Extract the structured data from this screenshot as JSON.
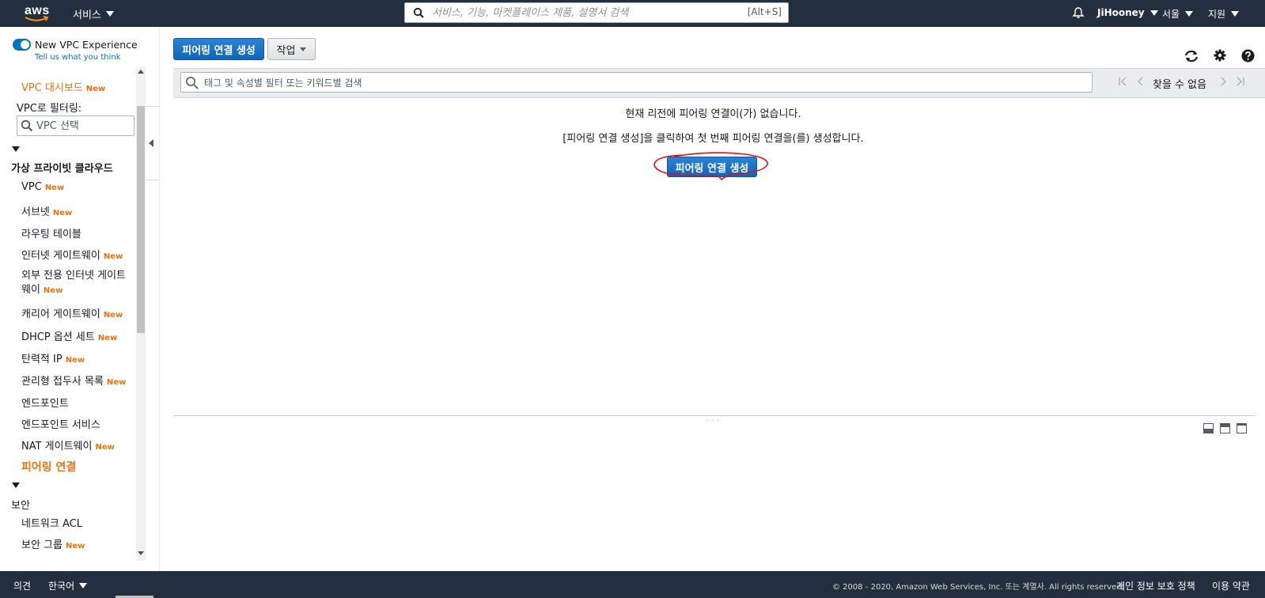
{
  "topnav": {
    "logo_text": "aws",
    "services_label": "서비스",
    "search_placeholder": "서비스, 기능, 마켓플레이스 제품, 설명서 검색",
    "search_shortcut": "[Alt+S]",
    "user_label": "JiHooney",
    "region_label": "서울",
    "support_label": "지원",
    "icons": [
      "search-icon",
      "bell-icon"
    ]
  },
  "sidebar": {
    "toggle_label": "New VPC Experience",
    "toggle_sub": "Tell us what you think",
    "toggle_on": true,
    "dashboard": "VPC 대시보드",
    "new_badge": "New",
    "filter_label": "VPC로 필터링:",
    "vpc_select_placeholder": "VPC 선택",
    "section_vpc": "가상 프라이빗 클라우드",
    "items": [
      {
        "label": "VPC",
        "new": true
      },
      {
        "label": "서브넷",
        "new": true
      },
      {
        "label": "라우팅 테이블",
        "new": false
      },
      {
        "label": "인터넷 게이트웨이",
        "new": true
      },
      {
        "label": "외부 전용 인터넷 게이트",
        "label2": "웨이",
        "new": true
      },
      {
        "label": "캐리어 게이트웨이",
        "new": true
      },
      {
        "label": "DHCP 옵션 세트",
        "new": true
      },
      {
        "label": "탄력적 IP",
        "new": true
      },
      {
        "label": "관리형 접두사 목록",
        "new": true
      },
      {
        "label": "엔드포인트",
        "new": false
      },
      {
        "label": "엔드포인트 서비스",
        "new": false
      },
      {
        "label": "NAT 게이트웨이",
        "new": true
      },
      {
        "label": "피어링 연결",
        "new": false,
        "active": true
      }
    ],
    "section_security": "보안",
    "security_items": [
      {
        "label": "네트워크 ACL",
        "new": false
      },
      {
        "label": "보안 그룹",
        "new": true
      }
    ]
  },
  "main": {
    "create_button": "피어링 연결 생성",
    "actions_button": "작업",
    "toolbar_icons": [
      "refresh-icon",
      "gear-icon",
      "help-icon"
    ],
    "filter_placeholder": "태그 및 속성별 필터 또는 키워드별 검색",
    "pager_text": "찾을 수 없음",
    "empty_line1": "현재 리전에 피어링 연결이(가) 없습니다.",
    "empty_line2": "[피어링 연결 생성]을 클릭하여 첫 번째 피어링 연결을(를) 생성합니다.",
    "empty_button": "피어링 연결 생성",
    "accent_color": "#ec7211",
    "primary_color": "#1a73c8",
    "annotation_color": "#e0101a"
  },
  "footer": {
    "feedback": "의견",
    "language": "한국어",
    "copyright": "© 2008 - 2020, Amazon Web Services, Inc. 또는 계열사. All rights reserved.",
    "privacy": "개인 정보 보호 정책",
    "terms": "이용 약관"
  }
}
